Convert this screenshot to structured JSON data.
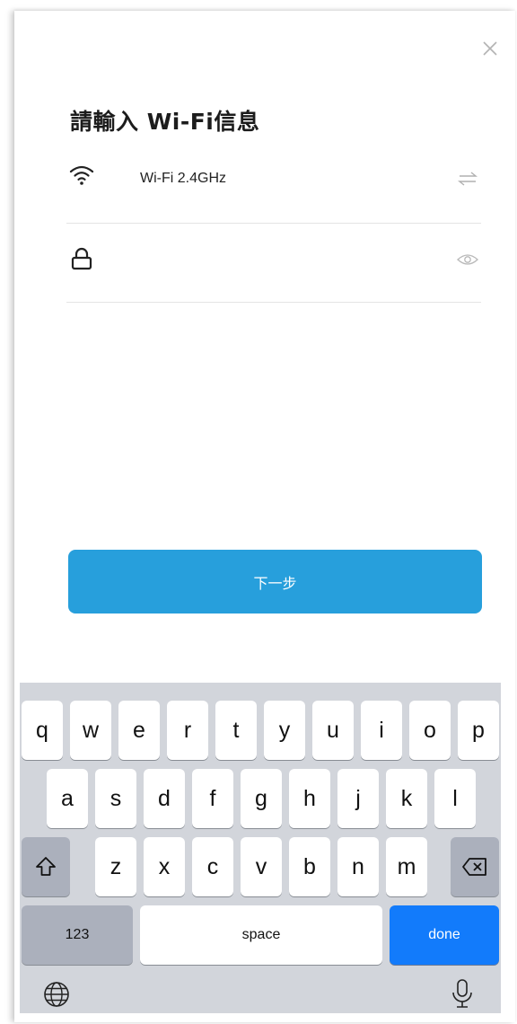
{
  "header": {
    "title": "請輸入 Wi-Fi信息"
  },
  "network": {
    "ssid": "Wi-Fi 2.4GHz"
  },
  "password": {
    "value": "",
    "placeholder": ""
  },
  "actions": {
    "next_label": "下一步"
  },
  "keyboard": {
    "row1": [
      "q",
      "w",
      "e",
      "r",
      "t",
      "y",
      "u",
      "i",
      "o",
      "p"
    ],
    "row2": [
      "a",
      "s",
      "d",
      "f",
      "g",
      "h",
      "j",
      "k",
      "l"
    ],
    "row3": [
      "z",
      "x",
      "c",
      "v",
      "b",
      "n",
      "m"
    ],
    "numbers_label": "123",
    "space_label": "space",
    "done_label": "done"
  },
  "icons": {
    "close": "close-icon",
    "wifi": "wifi-icon",
    "switch": "switch-network-icon",
    "lock": "lock-icon",
    "eye": "eye-icon",
    "shift": "shift-icon",
    "backspace": "backspace-icon",
    "globe": "globe-icon",
    "mic": "microphone-icon"
  },
  "colors": {
    "primary": "#279fdc",
    "keyboard_bg": "#d2d5db",
    "key_function": "#abb0bc",
    "done_key": "#127bfb"
  }
}
